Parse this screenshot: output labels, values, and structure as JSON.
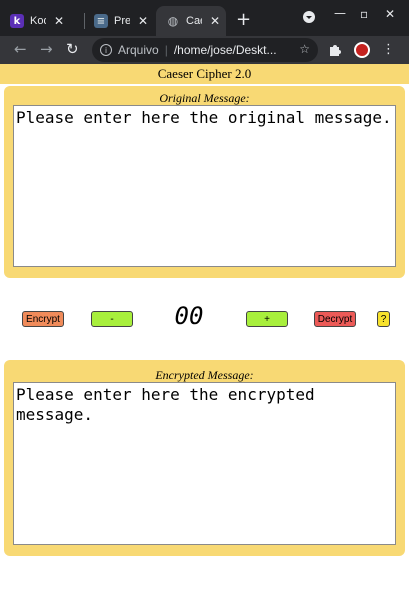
{
  "browser": {
    "tabs": [
      {
        "label": "Kodi",
        "favicon": "k",
        "favicon_color": "#5b2fb6"
      },
      {
        "label": "Prepa",
        "favicon": "p",
        "favicon_color": "#4a6a8a"
      },
      {
        "label": "Caes",
        "favicon": "globe",
        "favicon_color": "#bdc1c6",
        "active": true
      }
    ],
    "new_tab_icon": "plus-icon",
    "address": {
      "scheme": "Arquivo",
      "path": "/home/jose/Deskt..."
    },
    "colors": {
      "tabstrip": "#202124",
      "toolbar": "#35363a"
    }
  },
  "app": {
    "title": "Caeser Cipher 2.0",
    "original_label": "Original Message:",
    "original_placeholder": "Please enter here the original message.",
    "encrypted_label": "Encrypted Message:",
    "encrypted_placeholder": "Please enter here the encrypted message.",
    "shift_value": "00",
    "buttons": {
      "encrypt": {
        "label": "Encrypt",
        "color": "#f08b5a"
      },
      "minus": {
        "label": "-",
        "color": "#a8ef3c"
      },
      "plus": {
        "label": "+",
        "color": "#a8ef3c"
      },
      "decrypt": {
        "label": "Decrypt",
        "color": "#ec5a57"
      },
      "help": {
        "label": "?",
        "color": "#f7e22c"
      }
    },
    "colors": {
      "panel": "#f8d974"
    }
  }
}
